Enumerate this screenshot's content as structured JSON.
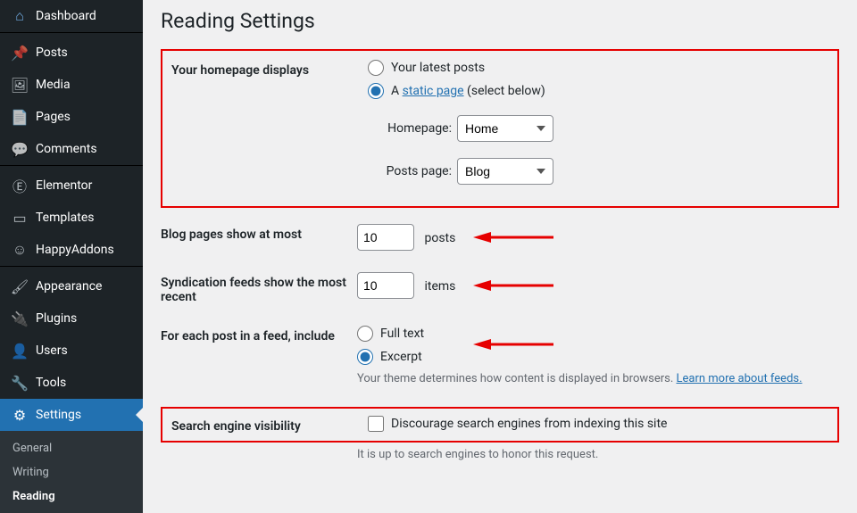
{
  "sidebar": {
    "items": [
      {
        "label": "Dashboard"
      },
      {
        "label": "Posts"
      },
      {
        "label": "Media"
      },
      {
        "label": "Pages"
      },
      {
        "label": "Comments"
      },
      {
        "label": "Elementor"
      },
      {
        "label": "Templates"
      },
      {
        "label": "HappyAddons"
      },
      {
        "label": "Appearance"
      },
      {
        "label": "Plugins"
      },
      {
        "label": "Users"
      },
      {
        "label": "Tools"
      },
      {
        "label": "Settings"
      }
    ],
    "submenu": [
      {
        "label": "General"
      },
      {
        "label": "Writing"
      },
      {
        "label": "Reading"
      }
    ]
  },
  "page": {
    "title": "Reading Settings"
  },
  "homepage": {
    "label": "Your homepage displays",
    "opt_latest": "Your latest posts",
    "opt_static_prefix": "A ",
    "opt_static_link": "static page",
    "opt_static_suffix": " (select below)",
    "homepage_label": "Homepage:",
    "homepage_value": "Home",
    "postspage_label": "Posts page:",
    "postspage_value": "Blog"
  },
  "blogpages": {
    "label": "Blog pages show at most",
    "value": "10",
    "unit": "posts"
  },
  "feeds": {
    "label": "Syndication feeds show the most recent",
    "value": "10",
    "unit": "items"
  },
  "feedcontent": {
    "label": "For each post in a feed, include",
    "opt_full": "Full text",
    "opt_excerpt": "Excerpt",
    "desc_prefix": "Your theme determines how content is displayed in browsers. ",
    "desc_link": "Learn more about feeds.",
    "desc_suffix": ""
  },
  "search": {
    "label": "Search engine visibility",
    "checkbox_label": "Discourage search engines from indexing this site",
    "desc": "It is up to search engines to honor this request."
  }
}
